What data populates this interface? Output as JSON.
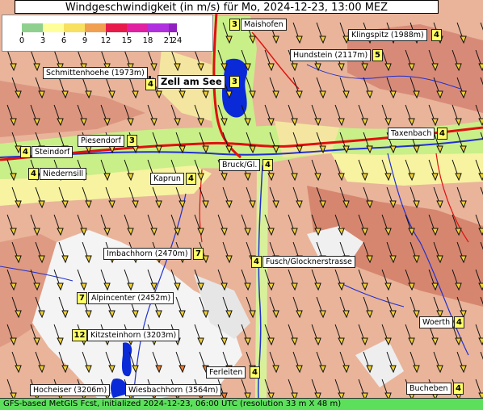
{
  "title": "Windgeschwindigkeit (in m/s) für Mo, 2024-12-23, 13:00 MEZ",
  "legend": {
    "ticks": [
      "0",
      "3",
      "6",
      "9",
      "12",
      "15",
      "18",
      "21",
      "24"
    ],
    "colors": [
      "#8fd08f",
      "#ffff99",
      "#f8e060",
      "#f0a050",
      "#e81a4a",
      "#e020a0",
      "#b030e0",
      "#9020c0"
    ]
  },
  "stations": [
    {
      "name": "Maishofen",
      "value": "3"
    },
    {
      "name": "Klingspitz (1988m)",
      "value": "4"
    },
    {
      "name": "Hundstein (2117m)",
      "value": "5"
    },
    {
      "name": "Schmittenhoehe (1973m)",
      "value": "4"
    },
    {
      "name": "Zell am See",
      "value": "3"
    },
    {
      "name": "Taxenbach",
      "value": "4"
    },
    {
      "name": "Piesendorf",
      "value": "3"
    },
    {
      "name": "Steindorf",
      "value": "4"
    },
    {
      "name": "Niedernsill",
      "value": "4"
    },
    {
      "name": "Kaprun",
      "value": "4"
    },
    {
      "name": "Bruck/Gl.",
      "value": "4"
    },
    {
      "name": "Imbachhorn (2470m)",
      "value": "7"
    },
    {
      "name": "Fusch/Glocknerstrasse",
      "value": "4"
    },
    {
      "name": "Alpincenter (2452m)",
      "value": "7"
    },
    {
      "name": "Kitzsteinhorn (3203m)",
      "value": "12"
    },
    {
      "name": "Woerth",
      "value": "4"
    },
    {
      "name": "Ferleiten",
      "value": "4"
    },
    {
      "name": "Hocheiser (3206m)",
      "value": ""
    },
    {
      "name": "Wiesbachhorn (3564m)",
      "value": ""
    },
    {
      "name": "Bucheben",
      "value": "4"
    }
  ],
  "footer": "GFS-based MetGIS Fcst, initialized 2024-12-23, 06:00 UTC  (resolution 33 m X 48 m)"
}
